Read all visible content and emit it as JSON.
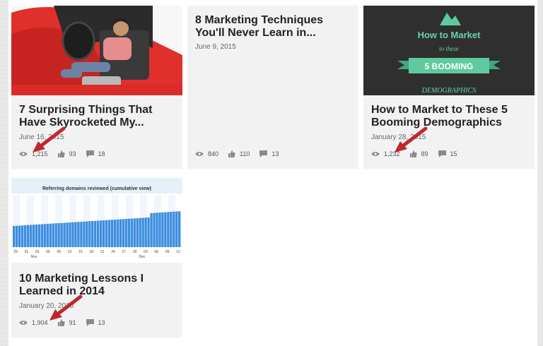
{
  "colors": {
    "stat_icon": "#8a8a8a",
    "arrow": "#c0272d",
    "card_bg": "#f2f2f2"
  },
  "cards": [
    {
      "title": "7 Surprising Things That Have Skyrocketed My...",
      "date": "June 16, 2015",
      "views": "1,215",
      "likes": "93",
      "comments": "18",
      "highlighted": true
    },
    {
      "title": "8 Marketing Techniques You'll Never Learn in...",
      "date": "June 9, 2015",
      "views": "840",
      "likes": "110",
      "comments": "13",
      "highlighted": false
    },
    {
      "title": "How to Market to These 5 Booming Demographics",
      "date": "January 28, 2015",
      "views": "1,232",
      "likes": "89",
      "comments": "15",
      "highlighted": true,
      "thumb": {
        "line1": "How to Market",
        "line2": "to these",
        "banner": "5 BOOMING",
        "line3": "DEMOGRAPHICS"
      }
    },
    {
      "title": "10 Marketing Lessons I Learned in 2014",
      "date": "January 20, 2015",
      "views": "1,904",
      "likes": "91",
      "comments": "13",
      "highlighted": true,
      "thumb": {
        "chart_title": "Referring domains reviewed (cumulative view)",
        "x_ticks": [
          "29",
          "31",
          "03",
          "06",
          "09",
          "12",
          "15",
          "18",
          "21",
          "24",
          "27",
          "30",
          "03",
          "06",
          "09",
          "12"
        ],
        "month_labels": [
          "Nov",
          "Dec"
        ]
      }
    }
  ]
}
